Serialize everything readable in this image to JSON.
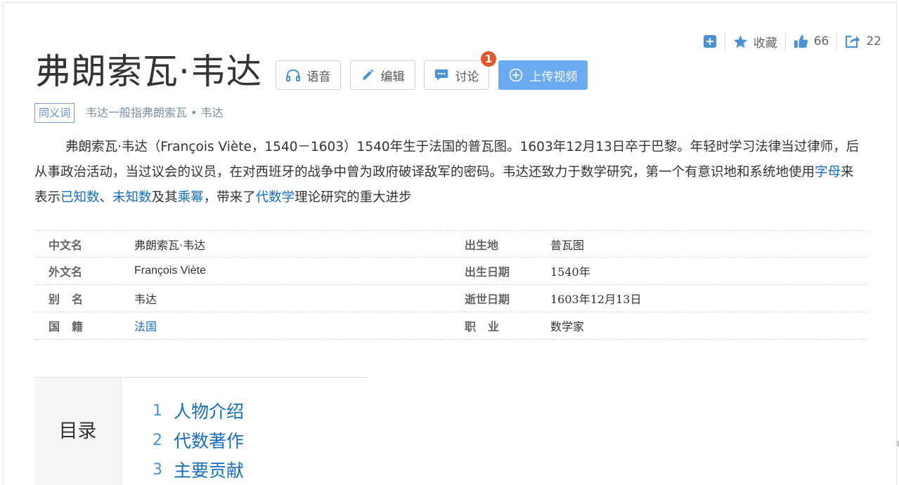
{
  "toolbar": {
    "add_icon": "plus-square-icon",
    "favorite_label": "收藏",
    "like_count": "66",
    "share_count": "22"
  },
  "title": "弗朗索瓦·韦达",
  "buttons": {
    "audio": "语音",
    "edit": "编辑",
    "discuss": "讨论",
    "discuss_badge": "1",
    "upload_video": "上传视频"
  },
  "synonym": {
    "tag": "同义词",
    "text": "韦达一般指弗朗索瓦 • 韦达"
  },
  "summary": {
    "part1": "弗朗索瓦·韦达（François Viète，1540－1603）1540年生于法国的普瓦图。1603年12月13日卒于巴黎。年轻时学习法律当过律师，后从事政治活动，当过议会的议员，在对西班牙的战争中曾为政府破译敌军的密码。韦达还致力于数学研究，第一个有意识地和系统地使用",
    "link1": "字母",
    "part2": "来表示",
    "link2": "已知数",
    "part3": "、",
    "link3": "未知数",
    "part4": "及其",
    "link4": "乘幂",
    "part5": "，带来了",
    "link5": "代数学",
    "part6": "理论研究的重大进步"
  },
  "info": {
    "rows": [
      {
        "k1": "中文名",
        "v1": "弗朗索瓦·韦达",
        "k2": "出生地",
        "v2": "普瓦图"
      },
      {
        "k1": "外文名",
        "v1": "François Viète",
        "k2": "出生日期",
        "v2": "1540年"
      },
      {
        "k1": "别名",
        "v1": "韦达",
        "k2": "逝世日期",
        "v2": "1603年12月13日"
      },
      {
        "k1": "国籍",
        "v1": "法国",
        "k2": "职业",
        "v2": "数学家"
      }
    ]
  },
  "catalog": {
    "heading": "目录",
    "items": [
      {
        "num": "1",
        "label": "人物介绍"
      },
      {
        "num": "2",
        "label": "代数著作"
      },
      {
        "num": "3",
        "label": "主要贡献"
      }
    ]
  },
  "colors": {
    "link": "#136ec2",
    "primary_button": "#6aaaf0",
    "badge": "#e8542a",
    "icon_blue": "#4b91d8"
  }
}
